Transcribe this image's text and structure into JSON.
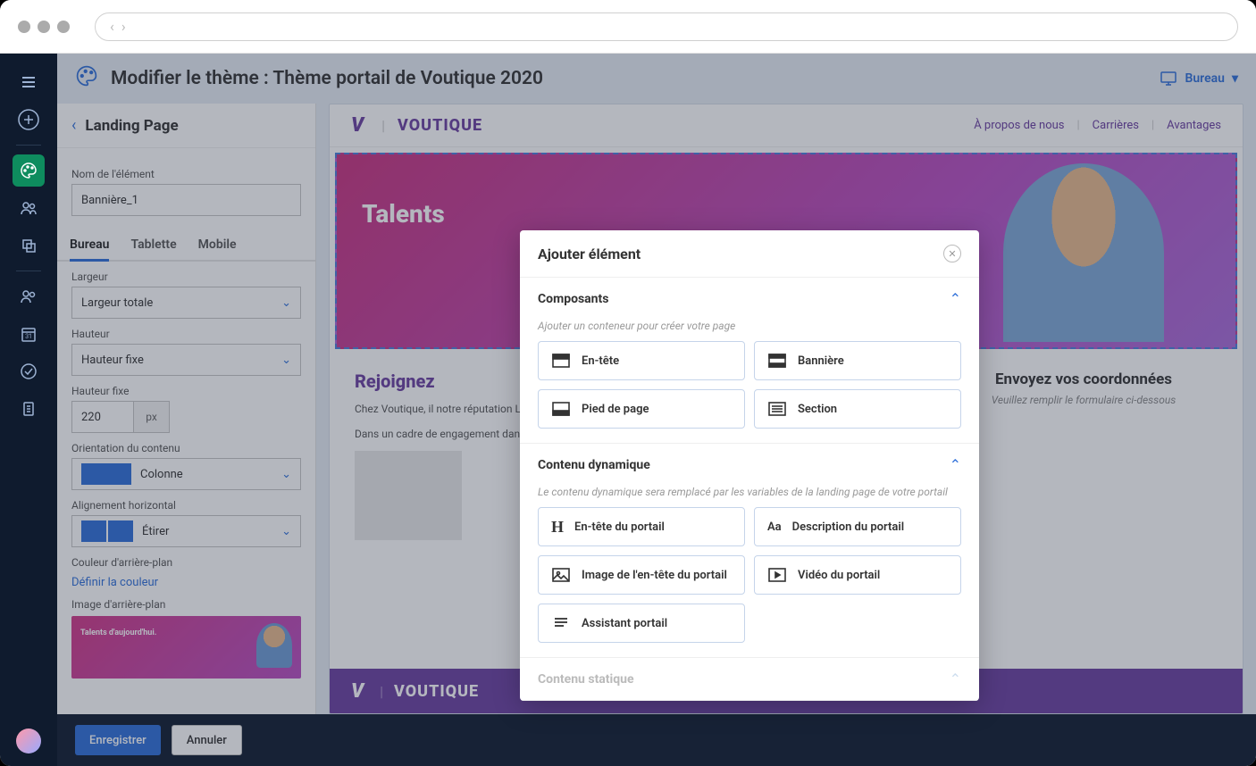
{
  "topbar": {
    "title": "Modifier le thème : Thème portail de Voutique 2020",
    "device_label": "Bureau"
  },
  "panel": {
    "title": "Landing Page",
    "element_name_label": "Nom de l'élément",
    "element_name_value": "Bannière_1",
    "tabs": {
      "desktop": "Bureau",
      "tablet": "Tablette",
      "mobile": "Mobile"
    },
    "width_label": "Largeur",
    "width_value": "Largeur totale",
    "height_label": "Hauteur",
    "height_value": "Hauteur fixe",
    "fixed_height_label": "Hauteur fixe",
    "fixed_height_value": "220",
    "fixed_height_unit": "px",
    "orientation_label": "Orientation du contenu",
    "orientation_value": "Colonne",
    "halign_label": "Alignement horizontal",
    "halign_value": "Étirer",
    "bgcolor_label": "Couleur d'arrière-plan",
    "bgcolor_link": "Définir la couleur",
    "bgimage_label": "Image d'arrière-plan",
    "thumb_text": "Talents d'aujourd'hui."
  },
  "preview": {
    "brand": "VOUTIQUE",
    "nav": {
      "about": "À propos de nous",
      "careers": "Carrières",
      "benefits": "Avantages"
    },
    "banner_title": "Talents",
    "join_heading": "Rejoignez",
    "para1": "Chez Voutique, il notre réputation La prise de risque responsabilité, ou",
    "para2": "Dans un cadre de engagement dans",
    "contact_heading": "Envoyez vos coordonnées",
    "contact_sub": "Veuillez remplir le formulaire ci-dessous"
  },
  "footer": {
    "save": "Enregistrer",
    "cancel": "Annuler"
  },
  "modal": {
    "title": "Ajouter élément",
    "section1": {
      "title": "Composants",
      "hint": "Ajouter un conteneur pour créer votre page",
      "items": {
        "header": "En-tête",
        "banner": "Bannière",
        "footer": "Pied de page",
        "section": "Section"
      }
    },
    "section2": {
      "title": "Contenu dynamique",
      "hint": "Le contenu dynamique sera remplacé par les variables de la landing page de votre portail",
      "items": {
        "portal_header": "En-tête du portail",
        "portal_desc": "Description du portail",
        "portal_header_img": "Image de l'en-tête du portail",
        "portal_video": "Vidéo du portail",
        "portal_assistant": "Assistant portail"
      }
    },
    "section3": {
      "title": "Contenu statique"
    }
  }
}
